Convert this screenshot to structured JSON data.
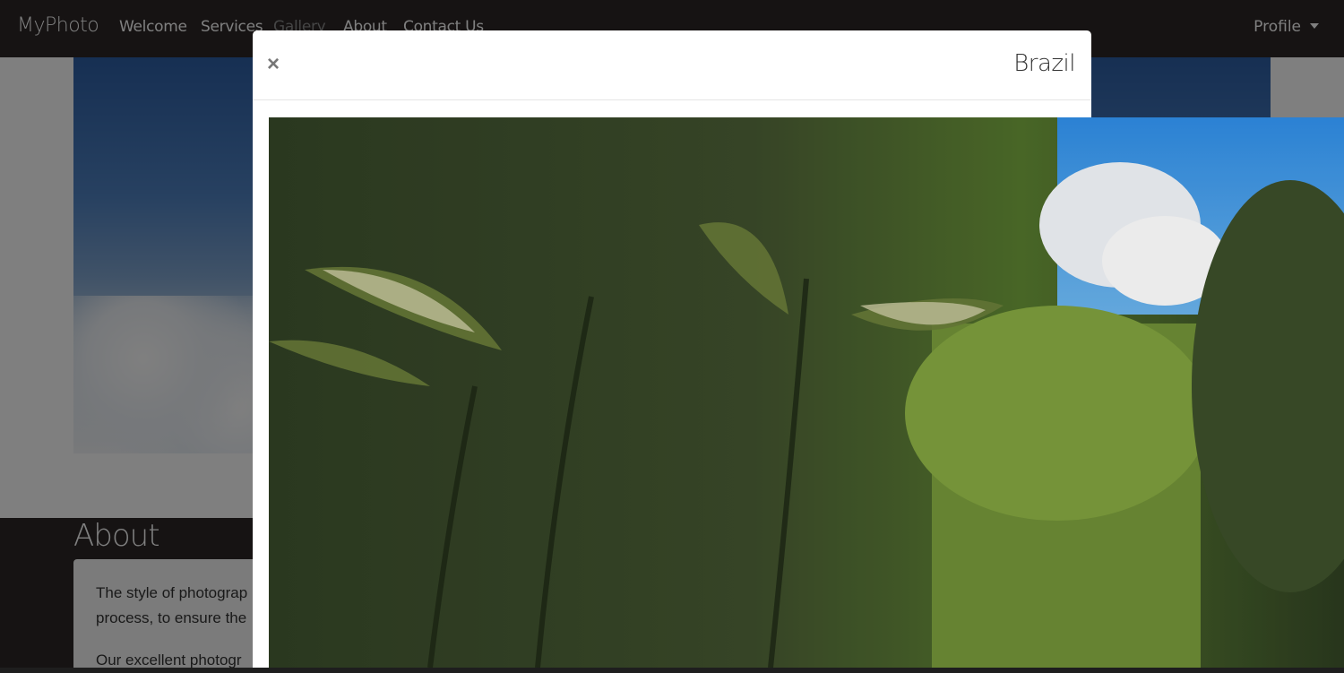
{
  "navbar": {
    "brand": "MyPhoto",
    "links": [
      {
        "label": "Welcome",
        "active": false
      },
      {
        "label": "Services",
        "active": false
      },
      {
        "label": "Gallery",
        "active": true
      },
      {
        "label": "About",
        "active": false
      },
      {
        "label": "Contact Us",
        "active": false
      }
    ],
    "profile_label": "Profile"
  },
  "about": {
    "heading": "About",
    "paragraphs": [
      "The style of photograp",
      "process, to ensure the",
      "Our excellent photogr"
    ]
  },
  "modal": {
    "title": "Brazil",
    "close_label": "×",
    "image_subject": "tropical palm trees and blue sky"
  },
  "colors": {
    "navbar_bg": "#2c2727",
    "backdrop": "rgba(0,0,0,0.5)",
    "modal_bg": "#ffffff",
    "active_link": "#8a8a8a"
  }
}
